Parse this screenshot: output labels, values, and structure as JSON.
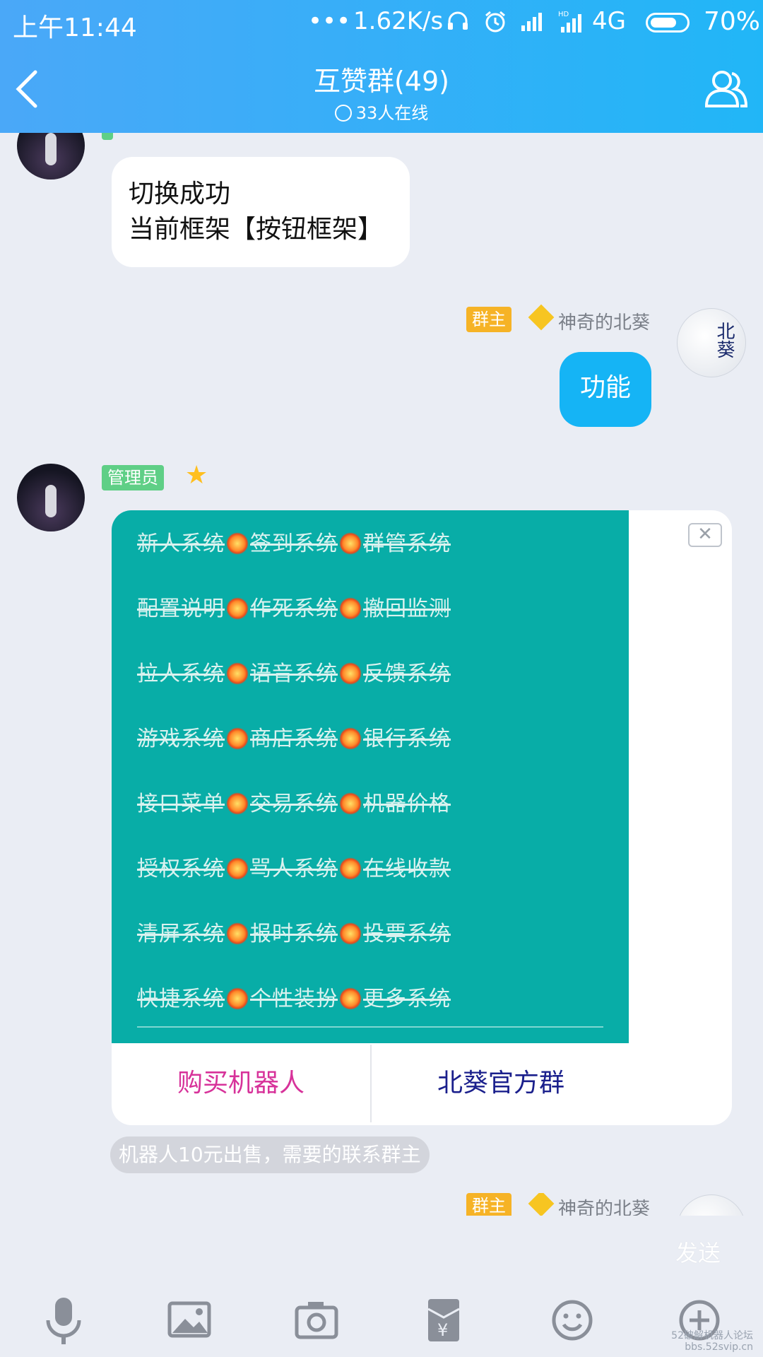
{
  "status": {
    "time": "上午11:44",
    "dots": "•••",
    "speed": "1.62K/s",
    "network": "4G",
    "battery": "70%"
  },
  "nav": {
    "title": "互赞群(49)",
    "online": "33人在线"
  },
  "messages": {
    "m1": {
      "line1": "切换成功",
      "line2": "当前框架【按钮框架】"
    },
    "m2": {
      "badge": "群主",
      "name": "神奇的北葵",
      "text": "功能",
      "avatar_text": "北葵"
    },
    "m3": {
      "badge": "管理员",
      "menu": [
        [
          "新人系统",
          "签到系统",
          "群管系统"
        ],
        [
          "配置说明",
          "作死系统",
          "撤回监测"
        ],
        [
          "拉人系统",
          "语音系统",
          "反馈系统"
        ],
        [
          "游戏系统",
          "商店系统",
          "银行系统"
        ],
        [
          "接口菜单",
          "交易系统",
          "机器价格"
        ],
        [
          "授权系统",
          "骂人系统",
          "在线收款"
        ],
        [
          "清屏系统",
          "报时系统",
          "投票系统"
        ],
        [
          "快捷系统",
          "个性装扮",
          "更多系统"
        ]
      ],
      "close": "✕",
      "btn_left": "购买机器人",
      "btn_right": "北葵官方群",
      "footnote": "机器人10元出售，需要的联系群主"
    },
    "m4": {
      "badge": "群主",
      "name": "神奇的北葵"
    }
  },
  "input": {
    "send": "发送"
  },
  "watermark": {
    "line1": "52破解机器人论坛",
    "line2": "bbs.52svip.cn"
  },
  "colors": {
    "header": "#21b6f7",
    "card_green": "#08ada7",
    "admin_badge": "#5fcf86",
    "owner_badge": "#f6b326",
    "buy_button": "#d7329a",
    "group_button": "#1a1f8c"
  },
  "icons": [
    "voice-icon",
    "image-icon",
    "camera-icon",
    "red-packet-icon",
    "emoji-icon",
    "plus-icon"
  ]
}
